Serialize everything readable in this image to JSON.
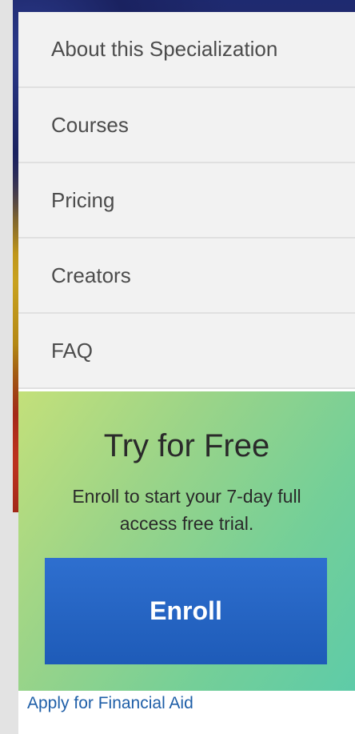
{
  "nav": {
    "items": [
      {
        "label": "About this Specialization"
      },
      {
        "label": "Courses"
      },
      {
        "label": "Pricing"
      },
      {
        "label": "Creators"
      },
      {
        "label": "FAQ"
      }
    ]
  },
  "trial": {
    "title": "Try for Free",
    "description": "Enroll to start your 7-day full access free trial.",
    "enroll_label": "Enroll"
  },
  "financial_aid": {
    "label": "Apply for Financial Aid"
  },
  "colors": {
    "enroll_button": "#2563c2",
    "link": "#1f5fa8",
    "gradient_start": "#c3e07a",
    "gradient_end": "#5ecba8"
  }
}
